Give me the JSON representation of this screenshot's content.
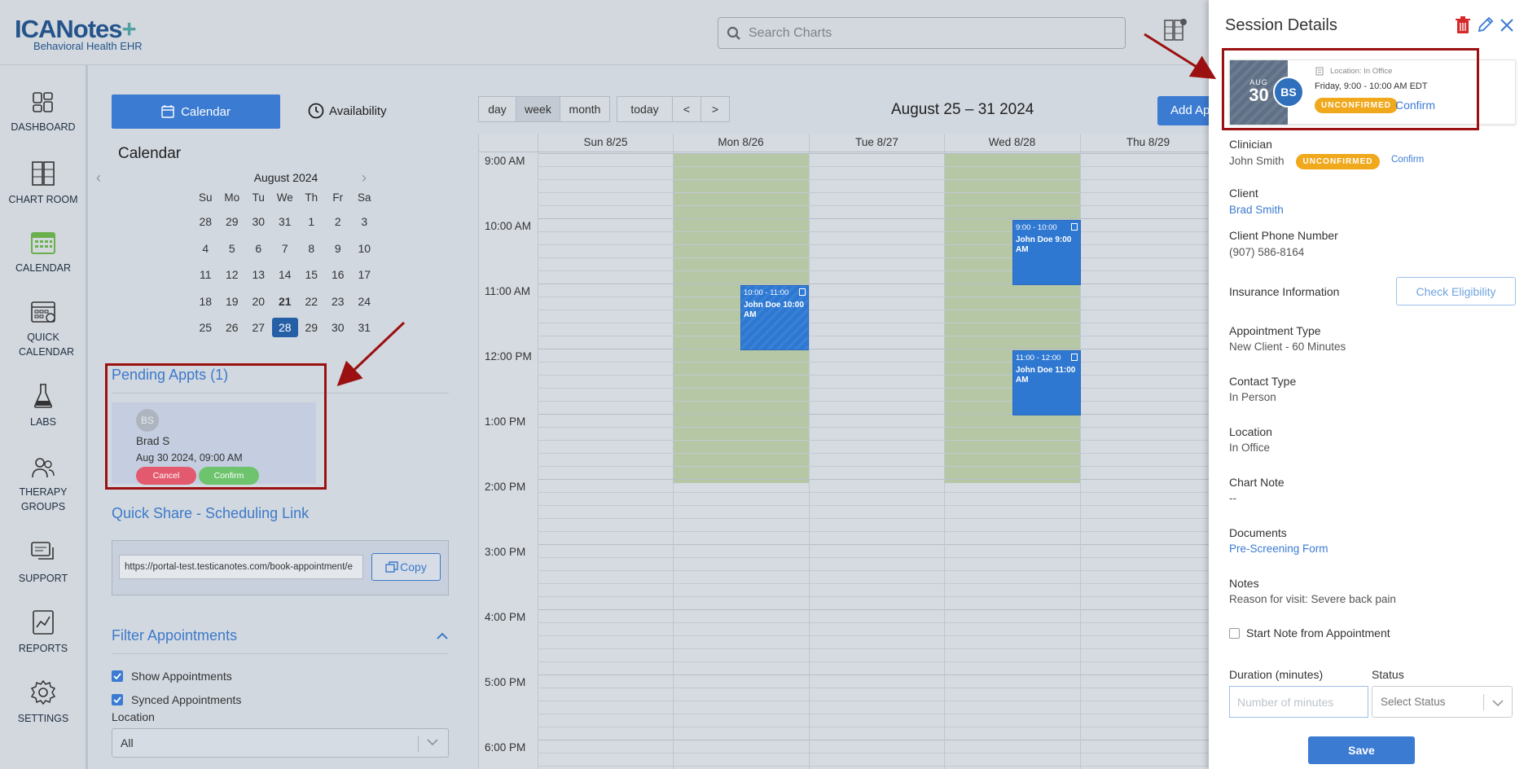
{
  "logo": {
    "main": "ICANotes",
    "sub": "Behavioral Health EHR"
  },
  "search": {
    "placeholder": "Search Charts"
  },
  "nav": [
    {
      "label": "DASHBOARD",
      "icon": "dashboard-icon"
    },
    {
      "label": "CHART ROOM",
      "icon": "chart-room-icon"
    },
    {
      "label": "CALENDAR",
      "icon": "calendar-icon"
    },
    {
      "label": "QUICK CALENDAR",
      "icon": "quick-calendar-icon"
    },
    {
      "label": "LABS",
      "icon": "flask-icon"
    },
    {
      "label": "THERAPY GROUPS",
      "icon": "groups-icon"
    },
    {
      "label": "SUPPORT",
      "icon": "support-icon"
    },
    {
      "label": "REPORTS",
      "icon": "reports-icon"
    },
    {
      "label": "SETTINGS",
      "icon": "gear-icon"
    }
  ],
  "left": {
    "tab_calendar": "Calendar",
    "tab_availability": "Availability",
    "calendar_title": "Calendar",
    "mini_month": "August 2024",
    "weekdays": [
      "Su",
      "Mo",
      "Tu",
      "We",
      "Th",
      "Fr",
      "Sa"
    ],
    "weeks": [
      [
        "28",
        "29",
        "30",
        "31",
        "1",
        "2",
        "3"
      ],
      [
        "4",
        "5",
        "6",
        "7",
        "8",
        "9",
        "10"
      ],
      [
        "11",
        "12",
        "13",
        "14",
        "15",
        "16",
        "17"
      ],
      [
        "18",
        "19",
        "20",
        "21",
        "22",
        "23",
        "24"
      ],
      [
        "25",
        "26",
        "27",
        "28",
        "29",
        "30",
        "31"
      ]
    ],
    "pending_title": "Pending Appts (1)",
    "pending": {
      "initials": "BS",
      "name": "Brad S",
      "datetime": "Aug 30 2024, 09:00 AM",
      "cancel": "Cancel",
      "confirm": "Confirm"
    },
    "quick_share_title": "Quick Share - Scheduling Link",
    "share_url": "https://portal-test.testicanotes.com/book-appointment/e",
    "copy": "Copy",
    "filter_title": "Filter Appointments",
    "show_appts": "Show Appointments",
    "synced_appts": "Synced Appointments",
    "location_label": "Location",
    "location_value": "All"
  },
  "calendar": {
    "views": [
      "day",
      "week",
      "month"
    ],
    "today": "today",
    "prev": "<",
    "next": ">",
    "range": "August 25 – 31 2024",
    "add": "Add Appointment",
    "days": [
      "Sun 8/25",
      "Mon 8/26",
      "Tue 8/27",
      "Wed 8/28",
      "Thu 8/29"
    ],
    "times": [
      "9:00 AM",
      "10:00 AM",
      "11:00 AM",
      "12:00 PM",
      "1:00 PM",
      "2:00 PM",
      "3:00 PM",
      "4:00 PM",
      "5:00 PM",
      "6:00 PM"
    ],
    "events": [
      {
        "time": "9:00 - 10:00",
        "title": "John Doe 9:00 AM"
      },
      {
        "time": "10:00 - 11:00",
        "title": "John Doe 10:00 AM"
      },
      {
        "time": "11:00 - 12:00",
        "title": "John Doe 11:00 AM"
      }
    ]
  },
  "panel": {
    "title": "Session Details",
    "card": {
      "month": "AUG",
      "day": "30",
      "initials": "BS",
      "location": "Location: In Office",
      "time": "Friday, 9:00 - 10:00 AM EDT",
      "badge": "UNCONFIRMED",
      "confirm": "Confirm"
    },
    "clinician_label": "Clinician",
    "clinician": "John Smith",
    "clinician_badge": "UNCONFIRMED",
    "clinician_confirm": "Confirm",
    "client_label": "Client",
    "client": "Brad Smith",
    "phone_label": "Client Phone Number",
    "phone": "(907) 586-8164",
    "insurance_label": "Insurance Information",
    "check_eligibility": "Check Eligibility",
    "appt_type_label": "Appointment Type",
    "appt_type": "New Client - 60 Minutes",
    "contact_label": "Contact Type",
    "contact": "In Person",
    "location_label": "Location",
    "location": "In Office",
    "chart_note_label": "Chart Note",
    "chart_note": "--",
    "documents_label": "Documents",
    "document": "Pre-Screening Form",
    "notes_label": "Notes",
    "notes": "Reason for visit: Severe back pain",
    "start_note": "Start Note from Appointment",
    "duration_label": "Duration (minutes)",
    "duration_placeholder": "Number of minutes",
    "status_label": "Status",
    "status_placeholder": "Select Status",
    "save": "Save"
  },
  "colors": {
    "primary": "#3b7bd2",
    "badge": "#f0a81c",
    "annotation": "#9b1010",
    "availability": "#b6c7a6"
  }
}
